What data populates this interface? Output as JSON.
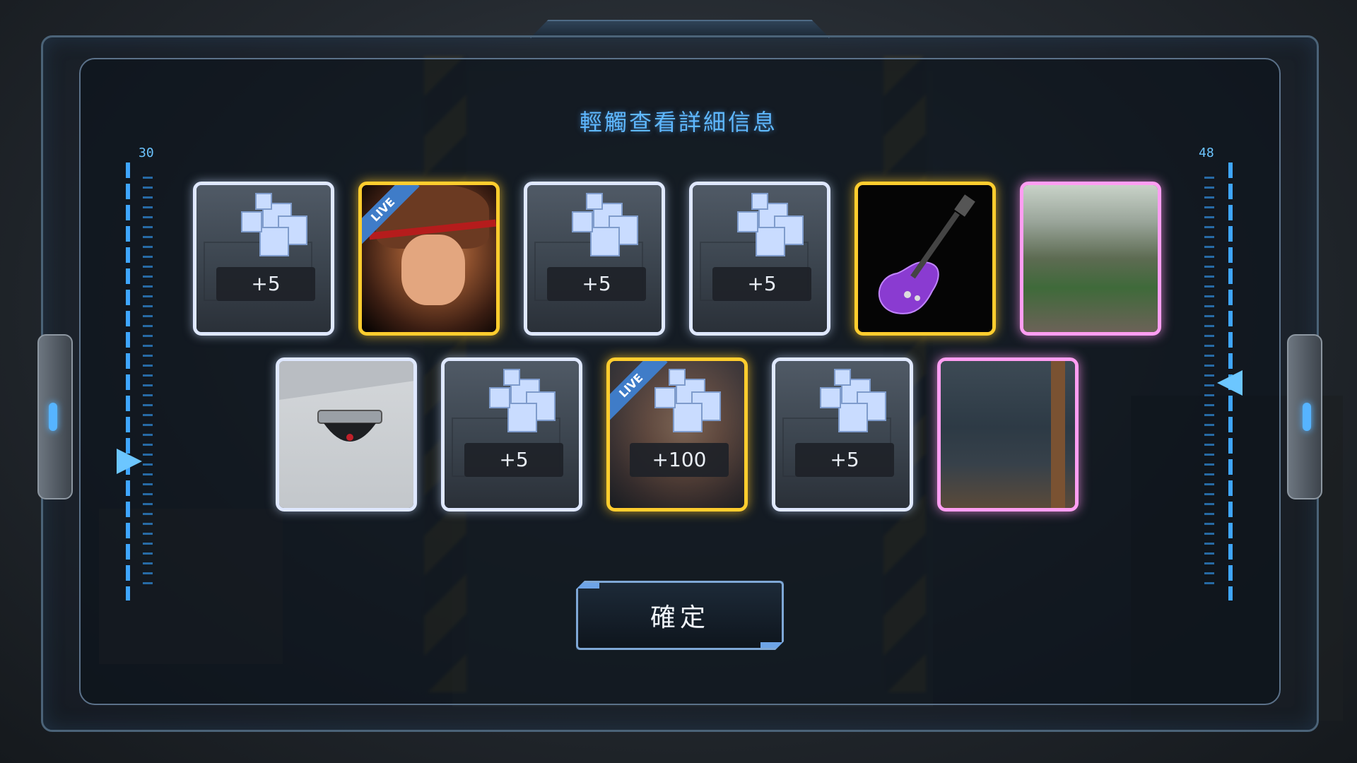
{
  "header": {
    "title": "輕觸查看詳細信息"
  },
  "gauges": {
    "left_value": "30",
    "right_value": "48"
  },
  "items_row1": [
    {
      "type": "cube",
      "amount": "+5",
      "rarity": "white"
    },
    {
      "type": "character",
      "badge": "LIVE",
      "rarity": "gold"
    },
    {
      "type": "cube",
      "amount": "+5",
      "rarity": "white"
    },
    {
      "type": "cube",
      "amount": "+5",
      "rarity": "white"
    },
    {
      "type": "guitar",
      "rarity": "gold"
    },
    {
      "type": "scene-field",
      "rarity": "pink"
    }
  ],
  "items_row2": [
    {
      "type": "camera",
      "rarity": "white"
    },
    {
      "type": "cube",
      "amount": "+5",
      "rarity": "white"
    },
    {
      "type": "cube-live",
      "amount": "+100",
      "badge": "LIVE",
      "rarity": "gold"
    },
    {
      "type": "cube",
      "amount": "+5",
      "rarity": "white"
    },
    {
      "type": "scene-dusk",
      "rarity": "pink"
    }
  ],
  "confirm": {
    "label": "確定"
  },
  "colors": {
    "accent": "#5fb8ff",
    "gold": "#ffcd2e",
    "pink": "#ff9ef2",
    "white": "#dfe8ff"
  }
}
